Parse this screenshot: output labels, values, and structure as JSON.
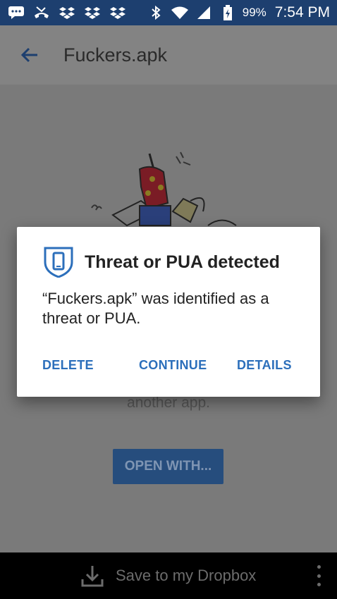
{
  "status_bar": {
    "battery": "99%",
    "time": "7:54 PM",
    "icons": [
      "chat-icon",
      "missed-call-icon",
      "dropbox-icon",
      "dropbox-icon",
      "dropbox-icon",
      "bluetooth-icon",
      "wifi-icon",
      "signal-icon",
      "battery-charging-icon"
    ]
  },
  "app_bar": {
    "title": "Fuckers.apk",
    "back_icon": "arrow-back-icon"
  },
  "background": {
    "partial_text": "another app.",
    "open_with_label": "OPEN WITH..."
  },
  "dialog": {
    "title": "Threat or PUA detected",
    "message": "“Fuckers.apk” was identified as a threat or PUA.",
    "buttons": {
      "delete": "DELETE",
      "continue": "CONTINUE",
      "details": "DETAILS"
    },
    "icon": "shield-phone-icon"
  },
  "bottom_bar": {
    "save_label": "Save to my Dropbox",
    "download_icon": "download-icon",
    "menu_icon": "more-vert-icon"
  },
  "colors": {
    "status_bar": "#1d3f6f",
    "accent": "#2c6fbb",
    "dim_background": "#7a7a7a",
    "bottom_bar": "#000000"
  }
}
